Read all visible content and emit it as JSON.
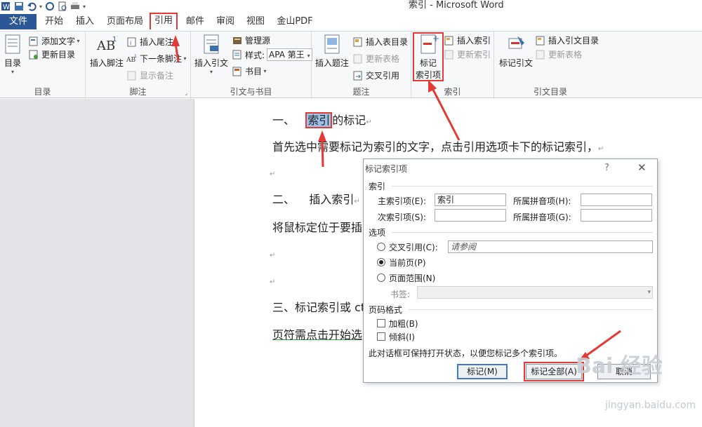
{
  "window": {
    "title": "索引 - Microsoft Word"
  },
  "tabs": [
    "文件",
    "开始",
    "插入",
    "页面布局",
    "引用",
    "邮件",
    "审阅",
    "视图",
    "金山PDF"
  ],
  "ribbon": {
    "toc": {
      "big": "目录",
      "add_text": "添加文字",
      "update": "更新目录",
      "label": "目录"
    },
    "footnote": {
      "insert_footnote": "插入脚注",
      "insert_endnote": "插入尾注",
      "next_footnote": "下一条脚注",
      "show_notes": "显示备注",
      "label": "脚注"
    },
    "citation": {
      "insert_citation": "插入引文",
      "manage_sources": "管理源",
      "style_label": "样式:",
      "style_value": "APA 第王",
      "bibliography": "书目",
      "label": "引文与书目"
    },
    "caption": {
      "insert_caption": "插入题注",
      "insert_tof": "插入表目录",
      "update_table": "更新表格",
      "cross_ref": "交叉引用",
      "label": "题注"
    },
    "index": {
      "mark_entry_1": "标记",
      "mark_entry_2": "索引项",
      "insert_index": "插入索引",
      "update_index": "更新索引",
      "label": "索引"
    },
    "toa": {
      "mark_citation": "标记引文",
      "insert_toa": "插入引文目录",
      "update_table": "更新表格",
      "label": "引文目录"
    }
  },
  "document": {
    "line1_prefix": "一、",
    "line1_hl": "索引",
    "line1_suffix": "的标记",
    "line2": "首先选中需要标记为索引的文字，点击引用选项卡下的标记索引，",
    "line3_prefix": "二、",
    "line3_text": "插入索引",
    "line4": "将鼠标定位于要插",
    "line5": "三、标记索引或 ct",
    "line6": "页符需点击开始选",
    "para_mark": "↵"
  },
  "dialog": {
    "title": "标记索引项",
    "help": "?",
    "close": "✕",
    "section_index": "索引",
    "main_entry_label": "主索引项(E):",
    "main_entry_value": "索引",
    "main_pinyin_label": "所属拼音项(H):",
    "sub_entry_label": "次索引项(S):",
    "sub_pinyin_label": "所属拼音项(G):",
    "section_options": "选项",
    "cross_ref_label": "交叉引用(C):",
    "cross_ref_value": "请参阅",
    "current_page": "当前页(P)",
    "page_range": "页面范围(N)",
    "bookmark_label": "书签:",
    "section_format": "页码格式",
    "bold": "加粗(B)",
    "italic": "倾斜(I)",
    "note": "此对话框可保持打开状态，以便您标记多个索引项。",
    "mark_btn": "标记(M)",
    "mark_all_btn": "标记全部(A)",
    "cancel_btn": "取消"
  },
  "watermark": {
    "brand": "Bai 经验",
    "url": "jingyan.baidu.com"
  }
}
